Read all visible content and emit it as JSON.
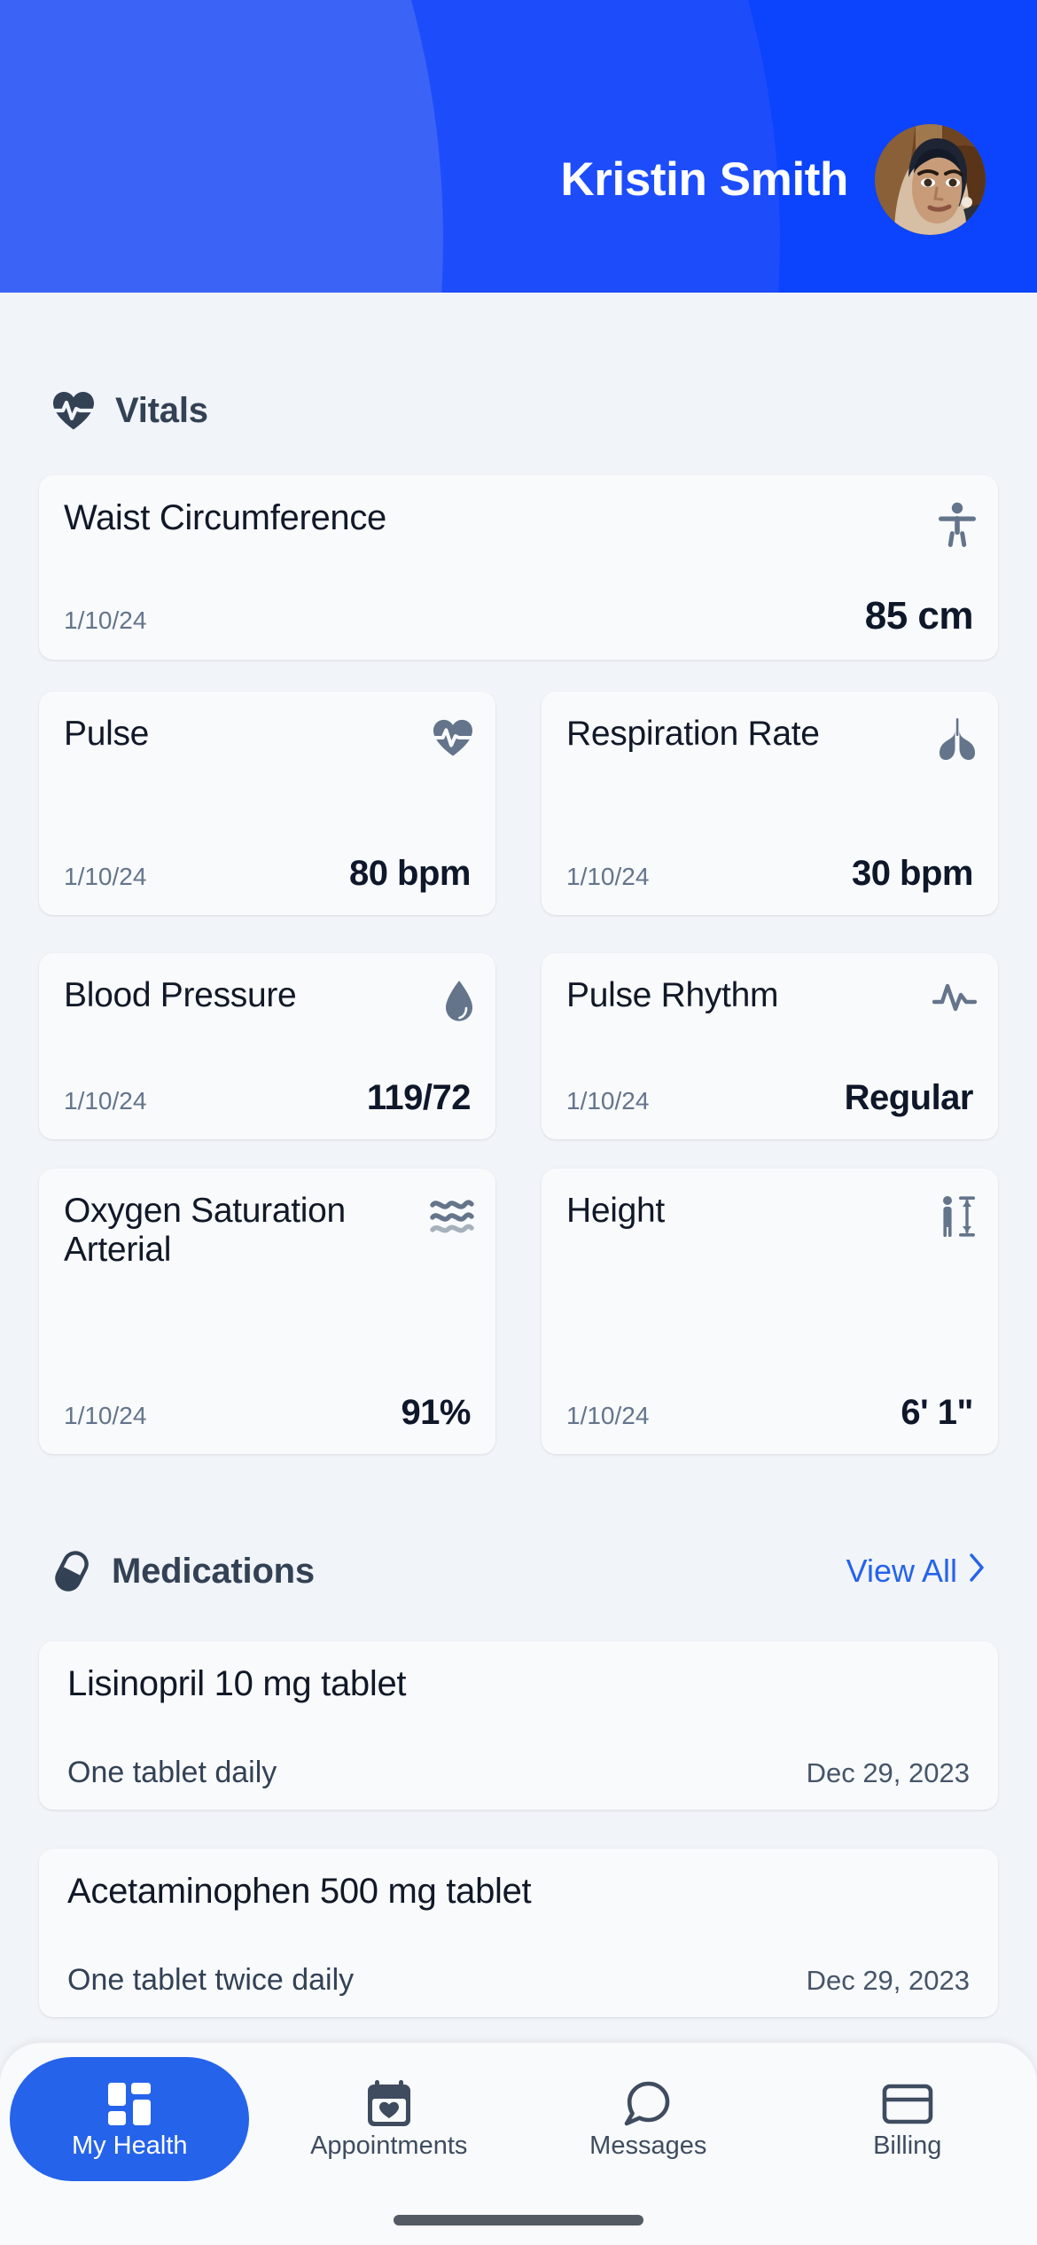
{
  "header": {
    "user_name": "Kristin Smith",
    "avatar_alt": "user-avatar",
    "bg_color_base": "#0B44FC",
    "bg_color_mid": "#1D4DFB",
    "bg_color_light": "#3B63F6"
  },
  "vitals": {
    "section_label": "Vitals",
    "section_icon": "heart-pulse-icon",
    "cards": [
      {
        "label": "Waist Circumference",
        "date": "1/10/24",
        "value": "85 cm",
        "icon": "body-measure-icon"
      },
      {
        "label": "Pulse",
        "date": "1/10/24",
        "value": "80 bpm",
        "icon": "heart-pulse-icon"
      },
      {
        "label": "Respiration Rate",
        "date": "1/10/24",
        "value": "30 bpm",
        "icon": "lungs-icon"
      },
      {
        "label": "Blood Pressure",
        "date": "1/10/24",
        "value": "119/72",
        "icon": "blood-drop-icon"
      },
      {
        "label": "Pulse Rhythm",
        "date": "1/10/24",
        "value": "Regular",
        "icon": "ecg-wave-icon"
      },
      {
        "label": "Oxygen Saturation Arterial",
        "date": "1/10/24",
        "value": "91%",
        "icon": "waves-icon"
      },
      {
        "label": "Height",
        "date": "1/10/24",
        "value": "6' 1\"",
        "icon": "height-ruler-icon"
      }
    ]
  },
  "medications": {
    "section_label": "Medications",
    "section_icon": "pill-icon",
    "view_all_label": "View All",
    "view_all_icon": "chevron-right-icon",
    "link_color": "#2563EB",
    "items": [
      {
        "name": "Lisinopril 10 mg tablet",
        "dose": "One tablet daily",
        "date": "Dec 29, 2023"
      },
      {
        "name": "Acetaminophen 500 mg tablet",
        "dose": "One tablet twice daily",
        "date": "Dec 29, 2023"
      }
    ]
  },
  "bottom_nav": {
    "active_color": "#2563EB",
    "items": [
      {
        "label": "My Health",
        "icon": "dashboard-grid-icon",
        "active": true
      },
      {
        "label": "Appointments",
        "icon": "calendar-heart-icon",
        "active": false
      },
      {
        "label": "Messages",
        "icon": "chat-bubble-icon",
        "active": false
      },
      {
        "label": "Billing",
        "icon": "credit-card-icon",
        "active": false
      }
    ]
  }
}
